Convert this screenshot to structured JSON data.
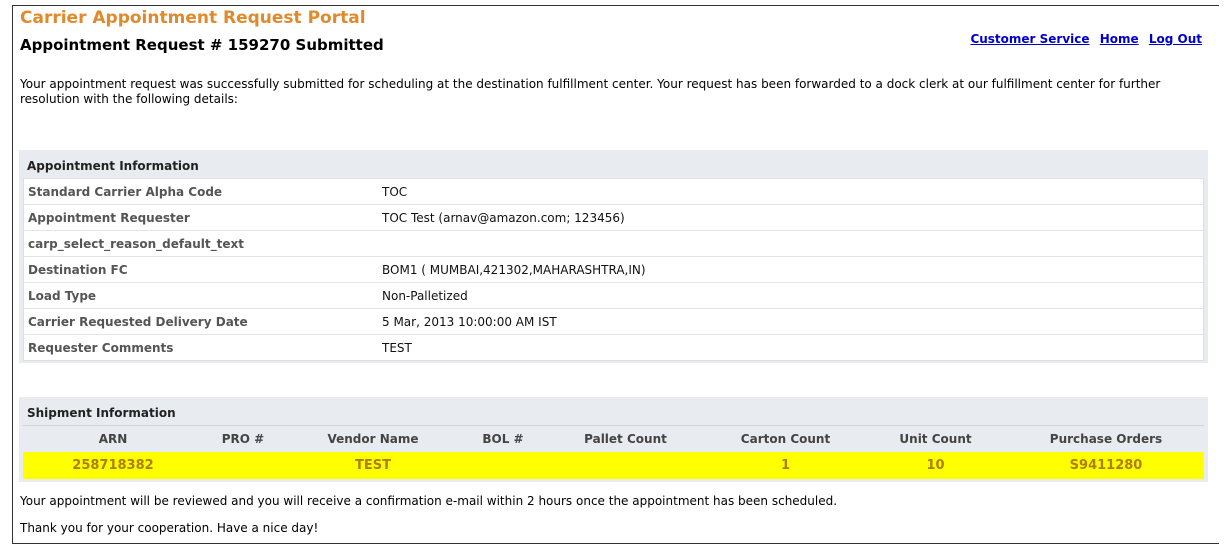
{
  "portal_title": "Carrier Appointment Request Portal",
  "page_title": "Appointment Request # 159270 Submitted",
  "nav": {
    "customer_service": "Customer Service",
    "home": "Home",
    "logout": "Log Out"
  },
  "intro": "Your appointment request was successfully submitted for scheduling at the destination fulfillment center. Your request has been forwarded to a dock clerk at our fulfillment center for further resolution with the following details:",
  "appointment": {
    "heading": "Appointment Information",
    "rows": [
      {
        "label": "Standard Carrier Alpha Code",
        "value": "TOC"
      },
      {
        "label": "Appointment Requester",
        "value": "TOC Test (arnav@amazon.com; 123456)"
      },
      {
        "label": "carp_select_reason_default_text",
        "value": ""
      },
      {
        "label": "Destination FC",
        "value": "BOM1 ( MUMBAI,421302,MAHARASHTRA,IN)"
      },
      {
        "label": "Load Type",
        "value": "Non-Palletized"
      },
      {
        "label": "Carrier Requested Delivery Date",
        "value": "5 Mar, 2013 10:00:00 AM IST"
      },
      {
        "label": "Requester Comments",
        "value": "TEST"
      }
    ]
  },
  "shipment": {
    "heading": "Shipment Information",
    "columns": [
      "ARN",
      "PRO #",
      "Vendor Name",
      "BOL #",
      "Pallet Count",
      "Carton Count",
      "Unit Count",
      "Purchase Orders"
    ],
    "row": [
      "258718382",
      "",
      "TEST",
      "",
      "",
      "1",
      "10",
      "S9411280"
    ],
    "highlight_color": "#ffff00"
  },
  "footer": {
    "review": "Your appointment will be reviewed and you will receive a confirmation e-mail within 2 hours once the appointment has been scheduled.",
    "thanks": "Thank you for your cooperation. Have a nice day!"
  }
}
